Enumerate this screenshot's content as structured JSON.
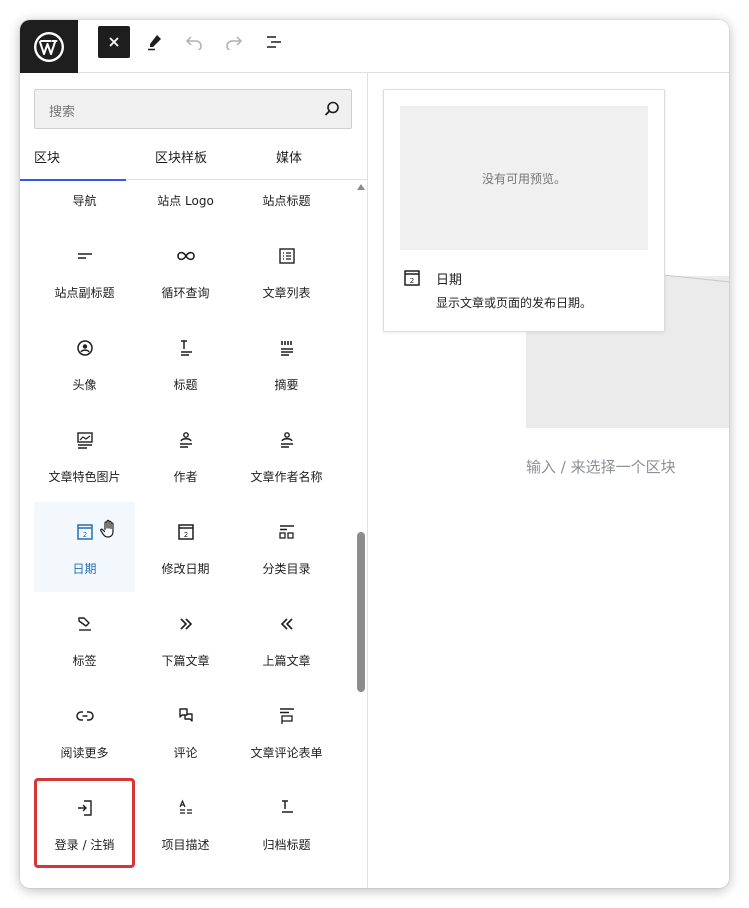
{
  "toolbar": {
    "logo_icon": "wordpress-logo",
    "buttons": [
      "close-icon",
      "pencil-icon",
      "undo-icon",
      "redo-icon",
      "list-view-icon"
    ]
  },
  "search": {
    "placeholder": "搜索"
  },
  "tabs": [
    {
      "label": "区块",
      "active": true
    },
    {
      "label": "区块样板",
      "active": false
    },
    {
      "label": "媒体",
      "active": false
    }
  ],
  "blocks": [
    {
      "label": "导航",
      "icon": "navigation-icon"
    },
    {
      "label": "站点 Logo",
      "icon": "site-logo-icon"
    },
    {
      "label": "站点标题",
      "icon": "map-marker-icon"
    },
    {
      "label": "站点副标题",
      "icon": "site-tagline-icon"
    },
    {
      "label": "循环查询",
      "icon": "loop-icon"
    },
    {
      "label": "文章列表",
      "icon": "post-list-icon"
    },
    {
      "label": "头像",
      "icon": "avatar-icon"
    },
    {
      "label": "标题",
      "icon": "post-title-icon"
    },
    {
      "label": "摘要",
      "icon": "excerpt-icon"
    },
    {
      "label": "文章特色图片",
      "icon": "featured-image-icon"
    },
    {
      "label": "作者",
      "icon": "author-icon"
    },
    {
      "label": "文章作者名称",
      "icon": "author-name-icon"
    },
    {
      "label": "日期",
      "icon": "calendar-icon",
      "selected": true
    },
    {
      "label": "修改日期",
      "icon": "calendar-icon"
    },
    {
      "label": "分类目录",
      "icon": "categories-icon"
    },
    {
      "label": "标签",
      "icon": "tag-icon"
    },
    {
      "label": "下篇文章",
      "icon": "next-icon"
    },
    {
      "label": "上篇文章",
      "icon": "previous-icon"
    },
    {
      "label": "阅读更多",
      "icon": "link-icon"
    },
    {
      "label": "评论",
      "icon": "comments-icon"
    },
    {
      "label": "文章评论表单",
      "icon": "comment-form-icon"
    },
    {
      "label": "登录 / 注销",
      "icon": "login-icon",
      "highlighted": true
    },
    {
      "label": "项目描述",
      "icon": "term-description-icon"
    },
    {
      "label": "归档标题",
      "icon": "archive-title-icon"
    }
  ],
  "preview": {
    "no_preview": "没有可用预览。",
    "title": "日期",
    "icon_number": "2",
    "description": "显示文章或页面的发布日期。"
  },
  "canvas": {
    "appender_text": "输入 / 来选择一个区块"
  },
  "colors": {
    "accent": "#3858e9",
    "selected_text": "#2271b1",
    "highlight_border": "#d63638",
    "dark": "#1e1e1e"
  }
}
